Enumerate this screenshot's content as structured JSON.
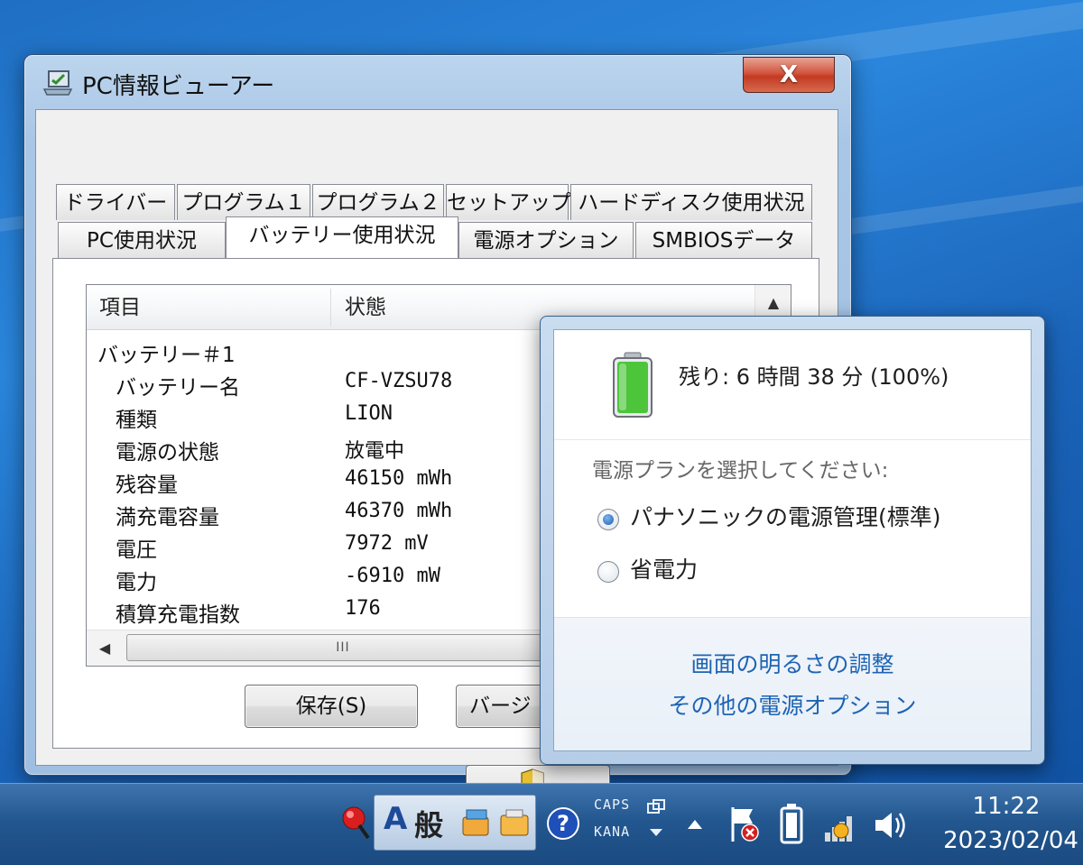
{
  "window": {
    "title": "PC情報ビューアー",
    "close_label": "X",
    "tabs_row1": [
      "ドライバー",
      "プログラム１",
      "プログラム２",
      "セットアップ",
      "ハードディスク使用状況"
    ],
    "tabs_row2": [
      "PC使用状況",
      "バッテリー使用状況",
      "電源オプション",
      "SMBIOSデータ"
    ],
    "active_tab": "バッテリー使用状況",
    "list": {
      "columns": [
        "項目",
        "状態"
      ],
      "group": "バッテリー＃1",
      "rows": [
        {
          "k": "バッテリー名",
          "v": "CF-VZSU78"
        },
        {
          "k": "種類",
          "v": "LION"
        },
        {
          "k": "電源の状態",
          "v": "放電中"
        },
        {
          "k": "残容量",
          "v": "46150 mWh"
        },
        {
          "k": "満充電容量",
          "v": "46370 mWh"
        },
        {
          "k": "電圧",
          "v": "7972 mV"
        },
        {
          "k": "電力",
          "v": "-6910 mW"
        },
        {
          "k": "積算充電指数",
          "v": "176"
        }
      ],
      "hscroll_grip": "III"
    },
    "buttons": {
      "save": "保存(S)",
      "version": "バージ"
    }
  },
  "flyout": {
    "remaining": "残り: 6 時間 38 分 (100%)",
    "battery_level": 1.0,
    "plan_label": "電源プランを選択してください:",
    "plans": [
      {
        "label": "パナソニックの電源管理(標準)",
        "selected": true
      },
      {
        "label": "省電力",
        "selected": false
      }
    ],
    "link_brightness": "画面の明るさの調整",
    "link_more": "その他の電源オプション"
  },
  "taskbar": {
    "ime_mode": "A",
    "ime_kanji": "般",
    "caps": "CAPS",
    "kana": "KANA",
    "time": "11:22",
    "date": "2023/02/04"
  },
  "colors": {
    "link": "#1e64b4",
    "battery_green": "#4cc53a"
  }
}
